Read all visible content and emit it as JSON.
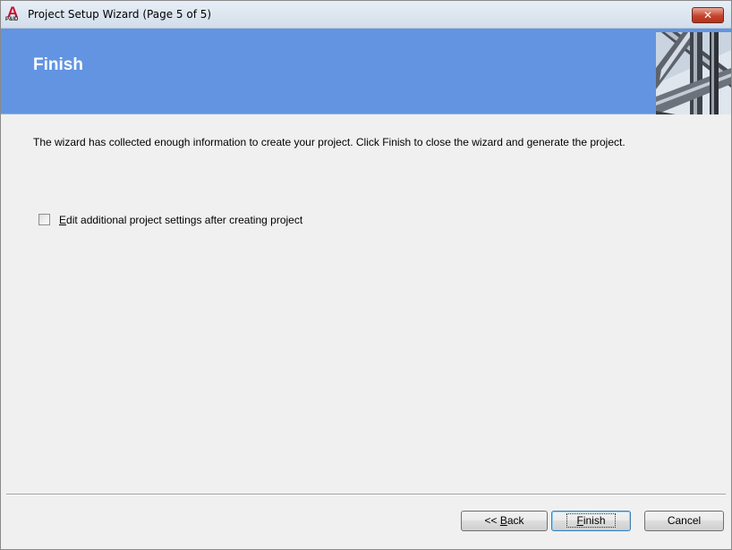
{
  "window": {
    "title": "Project Setup Wizard (Page 5 of 5)",
    "app_icon": "autocad-pid-icon",
    "close_label": "✕"
  },
  "banner": {
    "title": "Finish",
    "image": "pipes-banner-image",
    "color": "#6294e2"
  },
  "content": {
    "message": "The wizard has collected enough information to create your project. Click Finish to close the wizard and generate the project.",
    "checkbox": {
      "label_accel": "E",
      "label_rest": "dit additional project settings after creating project",
      "checked": false
    }
  },
  "buttons": {
    "back_prefix": "<< ",
    "back_accel": "B",
    "back_rest": "ack",
    "finish_accel": "F",
    "finish_rest": "inish",
    "cancel": "Cancel"
  }
}
